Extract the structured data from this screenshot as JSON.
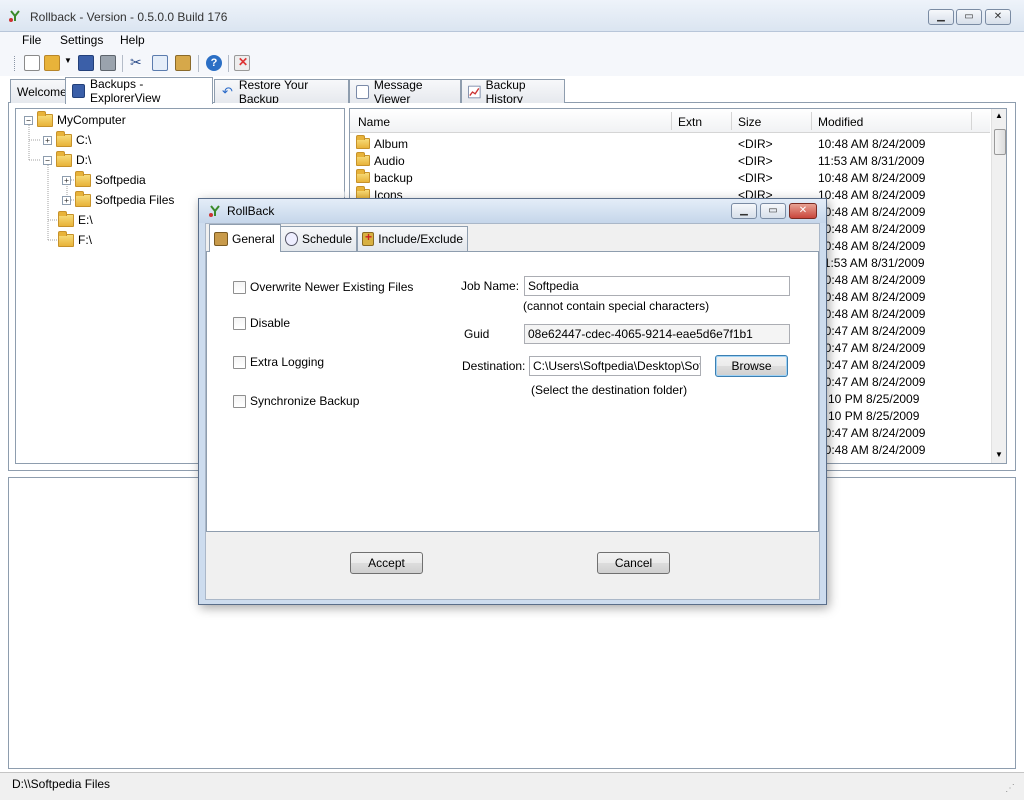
{
  "window": {
    "title": "Rollback - Version -  0.5.0.0 Build 176"
  },
  "menu": [
    "File",
    "Settings",
    "Help"
  ],
  "toolbar": {
    "icons": [
      "new-file-icon",
      "open-folder-icon",
      "save-icon",
      "print-icon",
      "cut-icon",
      "copy-icon",
      "paste-icon",
      "help-icon",
      "delete-icon"
    ]
  },
  "tabs": [
    {
      "label": "Welcome",
      "icon": ""
    },
    {
      "label": "Backups - ExplorerView",
      "icon": "floppy-disk-icon",
      "active": true
    },
    {
      "label": "Restore Your Backup",
      "icon": "restore-arrow-icon"
    },
    {
      "label": "Message Viewer",
      "icon": "message-document-icon"
    },
    {
      "label": "Backup History",
      "icon": "chart-icon"
    }
  ],
  "tree": {
    "root": "MyComputer",
    "nodes": [
      {
        "label": "C:\\",
        "expander": "+"
      },
      {
        "label": "D:\\",
        "expander": "-"
      },
      {
        "label": "Softpedia",
        "expander": "+"
      },
      {
        "label": "Softpedia Files",
        "expander": "+"
      },
      {
        "label": "E:\\",
        "expander": ""
      },
      {
        "label": "F:\\",
        "expander": ""
      }
    ]
  },
  "file_list": {
    "columns": [
      "Name",
      "Extn",
      "Size",
      "Modified"
    ],
    "rows": [
      {
        "name": "Album",
        "extn": "",
        "size": "<DIR>",
        "modified": "10:48 AM 8/24/2009"
      },
      {
        "name": "Audio",
        "extn": "",
        "size": "<DIR>",
        "modified": "11:53 AM 8/31/2009"
      },
      {
        "name": "backup",
        "extn": "",
        "size": "<DIR>",
        "modified": "10:48 AM 8/24/2009"
      },
      {
        "name": "Icons",
        "extn": "",
        "size": "<DIR>",
        "modified": "10:48 AM 8/24/2009"
      },
      {
        "name": "",
        "extn": "",
        "size": "",
        "modified": "10:48 AM 8/24/2009"
      },
      {
        "name": "",
        "extn": "",
        "size": "",
        "modified": "10:48 AM 8/24/2009"
      },
      {
        "name": "",
        "extn": "",
        "size": "",
        "modified": "10:48 AM 8/24/2009"
      },
      {
        "name": "",
        "extn": "",
        "size": "",
        "modified": "11:53 AM 8/31/2009"
      },
      {
        "name": "",
        "extn": "",
        "size": "",
        "modified": "10:48 AM 8/24/2009"
      },
      {
        "name": "",
        "extn": "",
        "size": "",
        "modified": "10:48 AM 8/24/2009"
      },
      {
        "name": "",
        "extn": "",
        "size": "",
        "modified": "10:48 AM 8/24/2009"
      },
      {
        "name": "",
        "extn": "",
        "size": "",
        "modified": "10:47 AM 8/24/2009"
      },
      {
        "name": "",
        "extn": "",
        "size": "",
        "modified": "10:47 AM 8/24/2009"
      },
      {
        "name": "",
        "extn": "",
        "size": "",
        "modified": "10:47 AM 8/24/2009"
      },
      {
        "name": "",
        "extn": "",
        "size": "",
        "modified": "10:47 AM 8/24/2009"
      },
      {
        "name": "",
        "extn": "",
        "size": "",
        "modified": "3:10 PM 8/25/2009"
      },
      {
        "name": "",
        "extn": "",
        "size": "",
        "modified": "3:10 PM 8/25/2009"
      },
      {
        "name": "",
        "extn": "",
        "size": "",
        "modified": "10:47 AM 8/24/2009"
      },
      {
        "name": "",
        "extn": "",
        "size": "",
        "modified": "10:48 AM 8/24/2009"
      }
    ]
  },
  "status": {
    "path": "D:\\\\Softpedia Files"
  },
  "dialog": {
    "title": "RollBack",
    "tabs": [
      "General",
      "Schedule",
      "Include/Exclude"
    ],
    "checkboxes": [
      "Overwrite Newer Existing Files",
      "Disable",
      "Extra Logging",
      "Synchronize Backup"
    ],
    "job_name_label": "Job Name:",
    "job_name_value": "Softpedia",
    "job_name_hint": "(cannot contain special characters)",
    "guid_label": "Guid",
    "guid_value": "08e62447-cdec-4065-9214-eae5d6e7f1b1",
    "destination_label": "Destination:",
    "destination_value": "C:\\Users\\Softpedia\\Desktop\\Softpedia",
    "browse_label": "Browse",
    "destination_hint": "(Select the destination folder)",
    "accept_label": "Accept",
    "cancel_label": "Cancel"
  },
  "watermark": "SOFTPEDIA",
  "colors": {
    "folder": "#e8b33a",
    "titlebar": "#dbe5f1",
    "dialog_frame": "#cddcee",
    "close_button": "#c9463d"
  }
}
